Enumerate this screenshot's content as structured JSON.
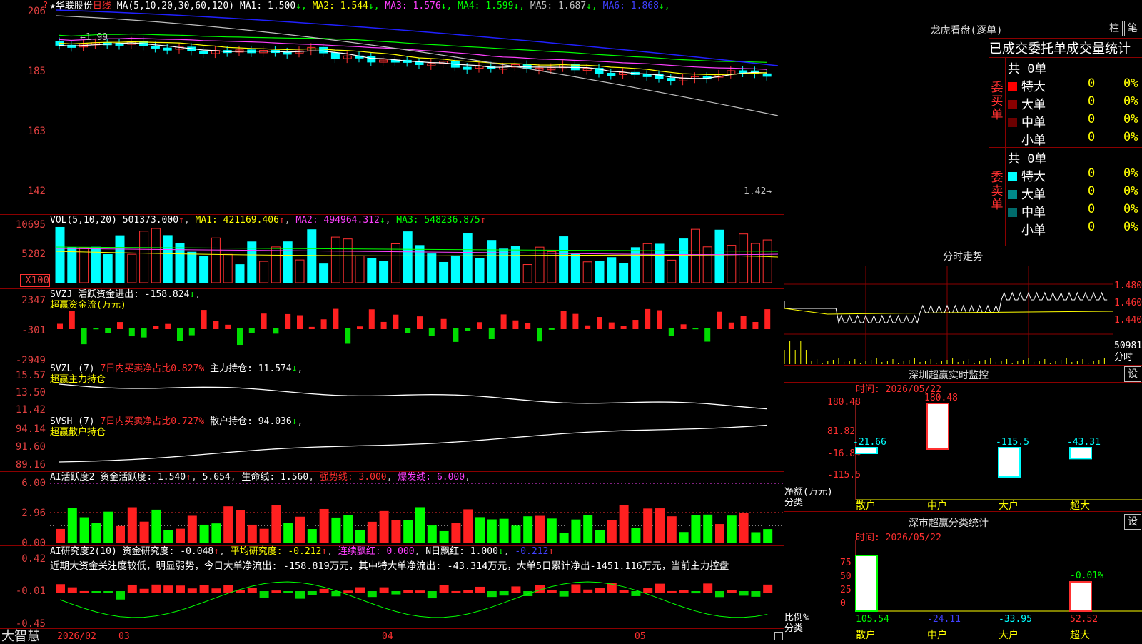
{
  "main": {
    "star": "★",
    "stock_name": "华联股份",
    "period": "日线",
    "ma_label": "MA(5,10,20,30,60,120)",
    "ma_values": [
      {
        "label": "MA1:",
        "value": "1.500",
        "arrow": "↓",
        "color": "#ffffff"
      },
      {
        "label": "MA2:",
        "value": "1.544",
        "arrow": "↓",
        "color": "#ffff00"
      },
      {
        "label": "MA3:",
        "value": "1.576",
        "arrow": "↓",
        "color": "#ff40ff"
      },
      {
        "label": "MA4:",
        "value": "1.599",
        "arrow": "↓",
        "color": "#00ff00"
      },
      {
        "label": "MA5:",
        "value": "1.687",
        "arrow": "↓",
        "color": "#c0c0c0"
      },
      {
        "label": "MA6:",
        "value": "1.868",
        "arrow": "↓",
        "color": "#4040ff"
      }
    ],
    "yaxis": [
      "206",
      "185",
      "163",
      "142"
    ],
    "high_marker": "1.99",
    "low_marker": "1.42"
  },
  "vol": {
    "label": "VOL(5,10,20)",
    "value": "501373.000",
    "arrow1": "↑",
    "ma1": "MA1: 421169.406",
    "ma1_arrow": "↑",
    "ma2": "MA2: 494964.312",
    "ma2_arrow": "↓",
    "ma3": "MA3: 548236.875",
    "ma3_arrow": "↑",
    "yaxis": [
      "10695",
      "5282"
    ],
    "unit": "X100"
  },
  "svzj": {
    "label": "SVZJ",
    "text": "活跃资金进出: -158.824",
    "arrow": "↓",
    "sub": "超赢资金流(万元)",
    "yaxis": [
      "2347",
      "-301",
      "-2949"
    ]
  },
  "svzl": {
    "label": "SVZL (7)",
    "text1": "7日内买卖净占比0.827%",
    "text2": "主力持仓: 11.574",
    "arrow": "↓",
    "sub": "超赢主力持仓",
    "yaxis": [
      "15.57",
      "13.50",
      "11.42"
    ]
  },
  "svsh": {
    "label": "SVSH (7)",
    "text1": "7日内买卖净占比0.727%",
    "text2": "散户持仓: 94.036",
    "arrow": "↓",
    "sub": "超赢散户持仓",
    "yaxis": [
      "94.14",
      "91.60",
      "89.16"
    ]
  },
  "ai1": {
    "label": "AI活跃度2",
    "t1": "资金活跃度: 1.540",
    "a1": "↑",
    "t2": "5.654",
    "t3": "生命线: 1.560",
    "t4": "强势线: 3.000",
    "t5": "爆发线: 6.000",
    "yaxis": [
      "6.00",
      "2.96",
      "0.00"
    ]
  },
  "ai2": {
    "label": "AI研究度2(10)",
    "t1": "资金研究度: -0.048",
    "a1": "↑",
    "t2": "平均研究度: -0.212",
    "a2": "↑",
    "t3": "连续飘红: 0.000",
    "t4": "N日飘红: 1.000",
    "a4": "↓",
    "t5": "-0.212",
    "a5": "↑",
    "summary": "近期大资金关注度较低，明显弱势，今日大单净流出: -158.819万元，其中特大单净流出: -43.314万元，大单5日累计净出-1451.116万元，当前主力控盘",
    "yaxis": [
      "0.42",
      "-0.01",
      "-0.45"
    ]
  },
  "xaxis": {
    "brand": "大智慧",
    "labels": [
      "2026/02",
      "03",
      "04",
      "05"
    ]
  },
  "right": {
    "dragon_title": "龙虎看盘(逐单)",
    "btn1": "柱",
    "btn2": "笔",
    "header": "已成交委托单成交量统计",
    "buy": {
      "side_label": "委买单",
      "total": "共 0单",
      "rows": [
        {
          "name": "特大",
          "count": "0",
          "pct": "0%",
          "color": "#ff0000"
        },
        {
          "name": "大单",
          "count": "0",
          "pct": "0%",
          "color": "#8b0000"
        },
        {
          "name": "中单",
          "count": "0",
          "pct": "0%",
          "color": "#6b0000"
        },
        {
          "name": "小单",
          "count": "0",
          "pct": "0%",
          "color": "#000000"
        }
      ]
    },
    "sell": {
      "side_label": "委卖单",
      "total": "共 0单",
      "rows": [
        {
          "name": "特大",
          "count": "0",
          "pct": "0%",
          "color": "#00ffff"
        },
        {
          "name": "大单",
          "count": "0",
          "pct": "0%",
          "color": "#008b8b"
        },
        {
          "name": "中单",
          "count": "0",
          "pct": "0%",
          "color": "#006b6b"
        },
        {
          "name": "小单",
          "count": "0",
          "pct": "0%",
          "color": "#000000"
        }
      ]
    },
    "intraday_title": "分时走势",
    "intraday_yaxis": [
      "1.480",
      "1.460",
      "1.440"
    ],
    "intraday_vol": "50981",
    "intraday_vol_label": "分时",
    "monitor": {
      "title": "深圳超赢实时监控",
      "settings": "设",
      "time": "时间: 2026/05/22",
      "yaxis": [
        "180.48",
        "81.82",
        "-16.84",
        "-115.5"
      ],
      "unit1": "净额(万元)",
      "unit2": "分类",
      "cats": [
        "散户",
        "中户",
        "大户",
        "超大"
      ],
      "values": [
        -21.66,
        180.48,
        -115.5,
        -43.31
      ],
      "value_labels": [
        "-21.66",
        "180.48",
        "-115.5",
        "-43.31"
      ]
    },
    "class_stats": {
      "title": "深市超赢分类统计",
      "settings": "设",
      "time": "时间: 2026/05/22",
      "yaxis": [
        "75",
        "50",
        "25",
        "0"
      ],
      "unit1": "比例%",
      "unit2": "分类",
      "cats": [
        "散户",
        "中户",
        "大户",
        "超大"
      ],
      "values": [
        105.54,
        -24.11,
        -33.95,
        52.52
      ],
      "value_labels": [
        "105.54",
        "-24.11",
        "-33.95",
        "52.52"
      ],
      "top_label": "-0.01%"
    }
  }
}
